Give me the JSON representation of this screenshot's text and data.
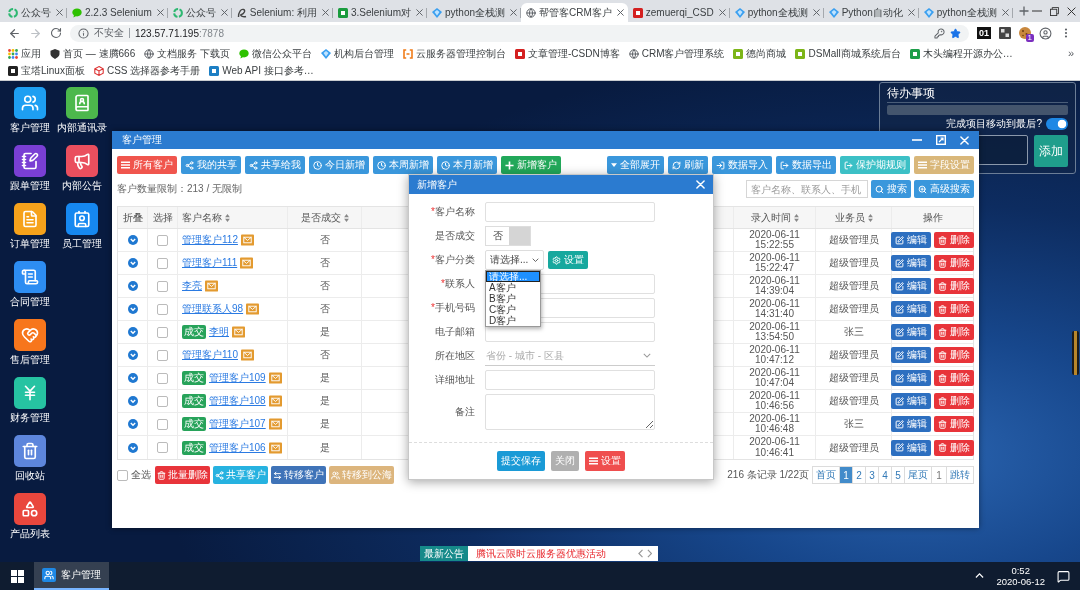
{
  "browser": {
    "tabs": [
      {
        "title": "公众号",
        "selected": false
      },
      {
        "title": "2.2.3 Selenium",
        "selected": false
      },
      {
        "title": "公众号",
        "selected": false
      },
      {
        "title": "Selenium: 利用",
        "selected": false
      },
      {
        "title": "3.Selenium对",
        "selected": false
      },
      {
        "title": "python全栈测",
        "selected": false
      },
      {
        "title": "帮管客CRM客户",
        "selected": true
      },
      {
        "title": "zemuerqi_CSD",
        "selected": false
      },
      {
        "title": "python全栈测",
        "selected": false
      },
      {
        "title": "Python自动化",
        "selected": false
      },
      {
        "title": "python全栈测",
        "selected": false
      }
    ],
    "address": {
      "security": "不安全",
      "host": "123.57.71.195",
      "port": ":7878"
    },
    "extensions": {
      "label": "01",
      "count": "1"
    },
    "bookmarks": [
      "应用",
      "首页 — 速腾666",
      "文档服务 下载页",
      "微信公众平台",
      "机构后台管理",
      "云服务器管理控制台",
      "文章管理-CSDN博客",
      "CRM客户管理系统",
      "德尚商城",
      "DSMall商城系统后台",
      "木头编程开源办公…",
      "宝塔Linux面板",
      "CSS 选择器参考手册",
      "Web API 接口参考…"
    ],
    "more": "»"
  },
  "desktop": {
    "shortcuts": [
      [
        "客户管理",
        "内部通讯录"
      ],
      [
        "跟单管理",
        "内部公告"
      ],
      [
        "订单管理",
        "员工管理"
      ],
      [
        "合同管理"
      ],
      [
        "售后管理"
      ],
      [
        "财务管理"
      ],
      [
        "回收站"
      ],
      [
        "产品列表"
      ]
    ],
    "todo": {
      "title": "待办事项",
      "toggle_label": "完成项目移动到最后?",
      "toggle_on": true,
      "add_button": "添加"
    },
    "notice": {
      "label": "最新公告",
      "text": "腾讯云限时云服务器优惠活动"
    }
  },
  "window": {
    "title": "客户管理",
    "filters": [
      {
        "label": "所有客户",
        "selected": true
      },
      {
        "label": "我的共享",
        "selected": false
      },
      {
        "label": "共享给我",
        "selected": false
      },
      {
        "label": "今日新增",
        "selected": false
      },
      {
        "label": "本周新增",
        "selected": false
      },
      {
        "label": "本月新增",
        "selected": false
      }
    ],
    "add_button": "新增客户",
    "tools": [
      "全部展开",
      "刷新",
      "数据导入",
      "数据导出",
      "保护期规则",
      "字段设置"
    ],
    "limit_text": "客户数量限制：213 / 无限制",
    "search": {
      "placeholder": "客户名称、联系人、手机",
      "button": "搜索",
      "advanced": "高级搜索"
    },
    "table": {
      "columns": [
        {
          "label": "折叠",
          "sortable": false
        },
        {
          "label": "选择",
          "sortable": false
        },
        {
          "label": "客户名称",
          "sortable": true
        },
        {
          "label": "是否成交",
          "sortable": true
        },
        {
          "label": "录入时间",
          "sortable": true
        },
        {
          "label": "业务员",
          "sortable": true
        },
        {
          "label": "操作",
          "sortable": false
        }
      ],
      "rows": [
        {
          "checked": false,
          "name": "管理客户112",
          "deal": "否",
          "time": "2020-06-11 15:22:55",
          "staff": "超级管理员",
          "actions": [
            "编辑",
            "删除"
          ]
        },
        {
          "checked": false,
          "name": "管理客户111",
          "deal": "否",
          "time": "2020-06-11 15:22:47",
          "staff": "超级管理员",
          "actions": [
            "编辑",
            "删除"
          ]
        },
        {
          "checked": false,
          "name": "李亮",
          "deal": "否",
          "time": "2020-06-11 14:39:04",
          "staff": "超级管理员",
          "actions": [
            "编辑",
            "删除"
          ]
        },
        {
          "checked": false,
          "name": "管理联系人98",
          "deal": "否",
          "time": "2020-06-11 14:31:40",
          "staff": "超级管理员",
          "actions": [
            "编辑",
            "删除"
          ]
        },
        {
          "checked": false,
          "badge": "成交",
          "name": "李明",
          "deal": "是",
          "time": "2020-06-11 13:54:50",
          "staff": "张三",
          "actions": [
            "编辑",
            "删除"
          ]
        },
        {
          "checked": false,
          "name": "管理客户110",
          "deal": "否",
          "time": "2020-06-11 10:47:12",
          "staff": "超级管理员",
          "actions": [
            "编辑",
            "删除"
          ]
        },
        {
          "checked": false,
          "badge": "成交",
          "name": "管理客户109",
          "deal": "是",
          "time": "2020-06-11 10:47:04",
          "staff": "超级管理员",
          "actions": [
            "编辑",
            "删除"
          ]
        },
        {
          "checked": false,
          "badge": "成交",
          "name": "管理客户108",
          "deal": "是",
          "time": "2020-06-11 10:46:56",
          "staff": "超级管理员",
          "actions": [
            "编辑",
            "删除"
          ]
        },
        {
          "checked": false,
          "badge": "成交",
          "name": "管理客户107",
          "deal": "是",
          "time": "2020-06-11 10:46:48",
          "staff": "张三",
          "actions": [
            "编辑",
            "删除"
          ]
        },
        {
          "checked": false,
          "badge": "成交",
          "name": "管理客户106",
          "deal": "是",
          "time": "2020-06-11 10:46:41",
          "staff": "超级管理员",
          "actions": [
            "编辑",
            "删除"
          ]
        }
      ]
    },
    "footer": {
      "select_all": {
        "label": "全选",
        "checked": false
      },
      "bulk": [
        "批量删除",
        "共享客户",
        "转移客户",
        "转移到公海"
      ],
      "summary": "216 条记录 1/22页",
      "first": "首页",
      "pages": [
        {
          "label": "1",
          "selected": true
        },
        {
          "label": "2",
          "selected": false
        },
        {
          "label": "3",
          "selected": false
        },
        {
          "label": "4",
          "selected": false
        },
        {
          "label": "5",
          "selected": false
        }
      ],
      "last": "尾页",
      "jump_value": "1",
      "jump": "跳转"
    },
    "modal": {
      "title": "新增客户",
      "fields": [
        {
          "kind": "input",
          "mark": "*",
          "label": "客户名称"
        },
        {
          "kind": "switch",
          "label": "是否成交",
          "on": false,
          "text": "否"
        },
        {
          "kind": "select",
          "mark": "*",
          "label": "客户分类",
          "value": "请选择...",
          "button": "设置",
          "expanded": true,
          "options": [
            {
              "label": "请选择...",
              "selected": true
            },
            {
              "label": "A客户",
              "selected": false
            },
            {
              "label": "B客户",
              "selected": false
            },
            {
              "label": "C客户",
              "selected": false
            },
            {
              "label": "D客户",
              "selected": false
            }
          ]
        },
        {
          "kind": "input",
          "mark": "*",
          "label": "联系人"
        },
        {
          "kind": "input",
          "mark": "*",
          "label": "手机号码"
        },
        {
          "kind": "input",
          "label": "电子邮箱"
        },
        {
          "kind": "region",
          "label": "所在地区",
          "placeholder": "省份 - 城市 - 区县"
        },
        {
          "kind": "input",
          "label": "详细地址"
        },
        {
          "kind": "textarea",
          "label": "备注"
        }
      ],
      "buttons": [
        "提交保存",
        "关闭",
        "设置"
      ]
    }
  },
  "taskbar": {
    "app": "客户管理",
    "time": "0:52",
    "date": "2020-06-12"
  }
}
